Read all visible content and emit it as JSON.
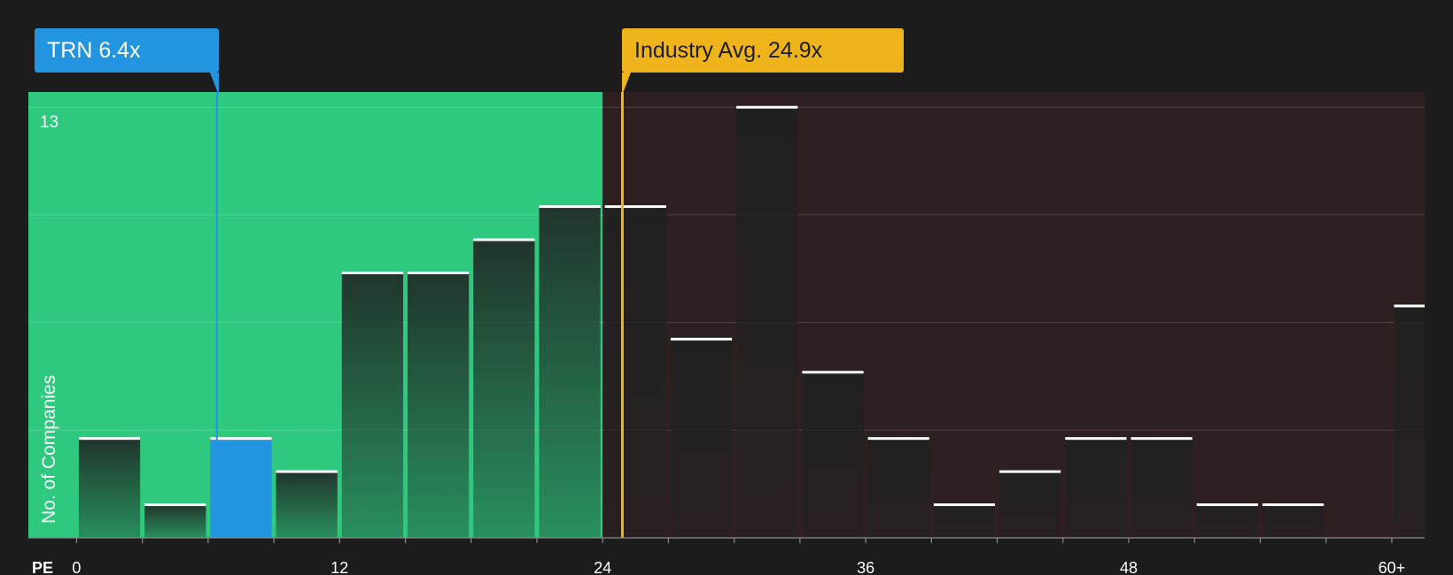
{
  "callouts": {
    "company": "TRN 6.4x",
    "industry": "Industry Avg. 24.9x"
  },
  "colors": {
    "background": "#1c1c1d",
    "below_avg_zone": "#2ec97e",
    "above_avg_zone": "#2e1f20",
    "company": "#2394e0",
    "industry": "#efb41c"
  },
  "chart_data": {
    "type": "bar",
    "title": "",
    "xlabel": "PE",
    "ylabel": "No. of Companies",
    "x_ticks": [
      {
        "value": 0,
        "label": "0"
      },
      {
        "value": 12,
        "label": "12"
      },
      {
        "value": 24,
        "label": "24"
      },
      {
        "value": 36,
        "label": "36"
      },
      {
        "value": 48,
        "label": "48"
      },
      {
        "value": 60,
        "label": "60+"
      }
    ],
    "y_tick_label": "13",
    "xlim": [
      -2.2,
      61.5
    ],
    "ylim": [
      0,
      13.46
    ],
    "y_gridlines": [
      3.25,
      6.5,
      9.75,
      13
    ],
    "bin_width": 3,
    "bins": [
      {
        "start": 0,
        "value": 3
      },
      {
        "start": 3,
        "value": 1
      },
      {
        "start": 6,
        "value": 3
      },
      {
        "start": 9,
        "value": 2
      },
      {
        "start": 12,
        "value": 8
      },
      {
        "start": 15,
        "value": 8
      },
      {
        "start": 18,
        "value": 9
      },
      {
        "start": 21,
        "value": 10
      },
      {
        "start": 24,
        "value": 10
      },
      {
        "start": 27,
        "value": 6
      },
      {
        "start": 30,
        "value": 13
      },
      {
        "start": 33,
        "value": 5
      },
      {
        "start": 36,
        "value": 3
      },
      {
        "start": 39,
        "value": 1
      },
      {
        "start": 42,
        "value": 2
      },
      {
        "start": 45,
        "value": 3
      },
      {
        "start": 48,
        "value": 3
      },
      {
        "start": 51,
        "value": 1
      },
      {
        "start": 54,
        "value": 1
      },
      {
        "start": 60,
        "value": 7
      }
    ],
    "company_pe": 6.4,
    "industry_avg_pe": 24.9,
    "below_avg_zone_end": 24
  }
}
